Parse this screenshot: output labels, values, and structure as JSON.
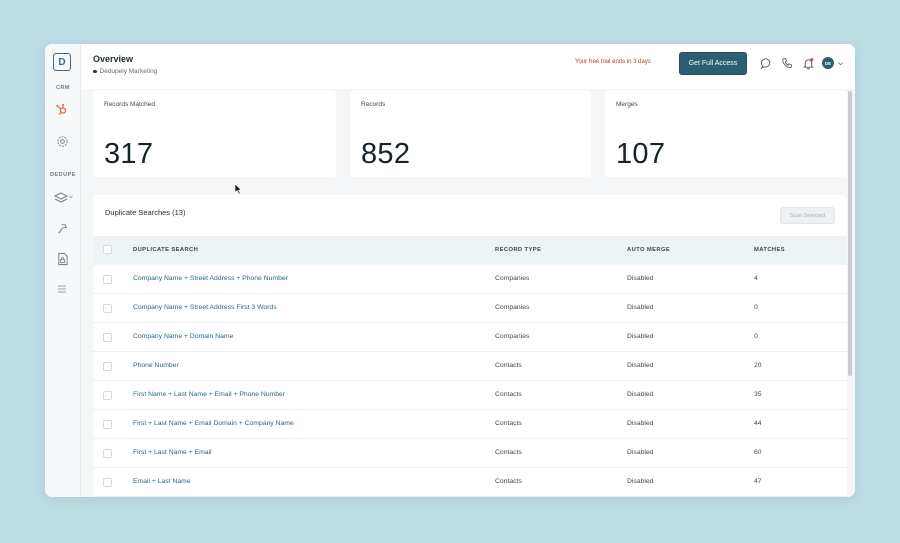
{
  "sidebar": {
    "logo_letter": "D",
    "crm_label": "CRM",
    "dedupe_label": "DEDUPE",
    "icons": [
      "hubspot-icon",
      "gear-icon",
      "layers-icon",
      "hammer-icon",
      "file-lock-icon",
      "list-icon"
    ]
  },
  "header": {
    "title": "Overview",
    "subtitle": "Dedupely Marketing",
    "trial_text": "Your free trial ends in 3 days",
    "cta_label": "Get Full Access",
    "avatar_initials": "DE"
  },
  "stats": [
    {
      "label": "Records Matched",
      "value": "317"
    },
    {
      "label": "Records",
      "value": "852"
    },
    {
      "label": "Merges",
      "value": "107"
    }
  ],
  "searches": {
    "title": "Duplicate Searches (13)",
    "scan_button": "Scan Selected",
    "columns": [
      "DUPLICATE SEARCH",
      "RECORD TYPE",
      "AUTO MERGE",
      "MATCHES"
    ],
    "rows": [
      {
        "search": "Company Name + Street Address + Phone Number",
        "type": "Companies",
        "auto_merge": "Disabled",
        "matches": "4"
      },
      {
        "search": "Company Name + Street Address First 3 Words",
        "type": "Companies",
        "auto_merge": "Disabled",
        "matches": "0"
      },
      {
        "search": "Company Name + Domain Name",
        "type": "Companies",
        "auto_merge": "Disabled",
        "matches": "0"
      },
      {
        "search": "Phone Number",
        "type": "Contacts",
        "auto_merge": "Disabled",
        "matches": "20"
      },
      {
        "search": "First Name + Last Name + Email + Phone Number",
        "type": "Contacts",
        "auto_merge": "Disabled",
        "matches": "35"
      },
      {
        "search": "First + Last Name + Email Domain + Company Name",
        "type": "Contacts",
        "auto_merge": "Disabled",
        "matches": "44"
      },
      {
        "search": "First + Last Name + Email",
        "type": "Contacts",
        "auto_merge": "Disabled",
        "matches": "60"
      },
      {
        "search": "Email + Last Name",
        "type": "Contacts",
        "auto_merge": "Disabled",
        "matches": "47"
      }
    ]
  },
  "colors": {
    "accent": "#2c5f72",
    "background": "#bcdde4",
    "alert": "#c0392b"
  }
}
